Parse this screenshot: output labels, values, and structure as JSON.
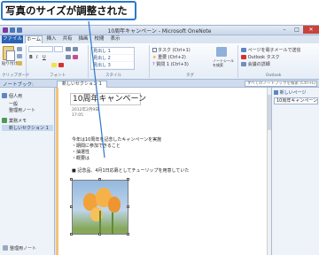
{
  "callout": {
    "text": "写真のサイズが調整された"
  },
  "window": {
    "title": "10周年キャンペーン - Microsoft OneNote"
  },
  "ribbon": {
    "tabs": [
      "ファイル",
      "ホーム",
      "挿入",
      "共有",
      "描画",
      "校閲",
      "表示"
    ],
    "groups": {
      "clipboard": "クリップボード",
      "font": "フォント",
      "styles": "スタイル",
      "tags": "タグ",
      "outlook": "Outlook"
    },
    "paste_label": "貼り付け",
    "styles_list": [
      "見出し 1",
      "見出し 2",
      "見出し 3"
    ],
    "tags_list": [
      "タスク (Ctrl+1)",
      "重要 (Ctrl+2)",
      "質問 1 (Ctrl+3)"
    ],
    "tags_button": "ノートシールを検索",
    "outlook_items": [
      "ページを電子メールで送信",
      "Outlook タスク",
      "会議の詳細"
    ]
  },
  "notebook_bar": {
    "label": "ノートブック:",
    "section_tab": "新しいセクション 1",
    "search_placeholder": "すべてのノートブックを検索 (Ctrl+E)"
  },
  "sidebar": {
    "items": [
      {
        "label": "個人用"
      },
      {
        "label": "一般"
      },
      {
        "label": "整理用ノート"
      },
      {
        "label": "業務メモ"
      },
      {
        "label": "新しいセクション 1"
      }
    ],
    "footer": "整理用ノート"
  },
  "page": {
    "title": "10周年キャンペーン",
    "date": "2012年2月9日",
    "time": "17:05",
    "lines": [
      "今年は10周年を記念したキャンペーンを実施",
      "・期間に参加できること",
      "・抽選性",
      "・概要は",
      "■ 記念品、4月1日応募としてチューリップを用意していた"
    ]
  },
  "pages_panel": {
    "new_page": "新しいページ",
    "items": [
      "10周年キャンペーン"
    ]
  }
}
